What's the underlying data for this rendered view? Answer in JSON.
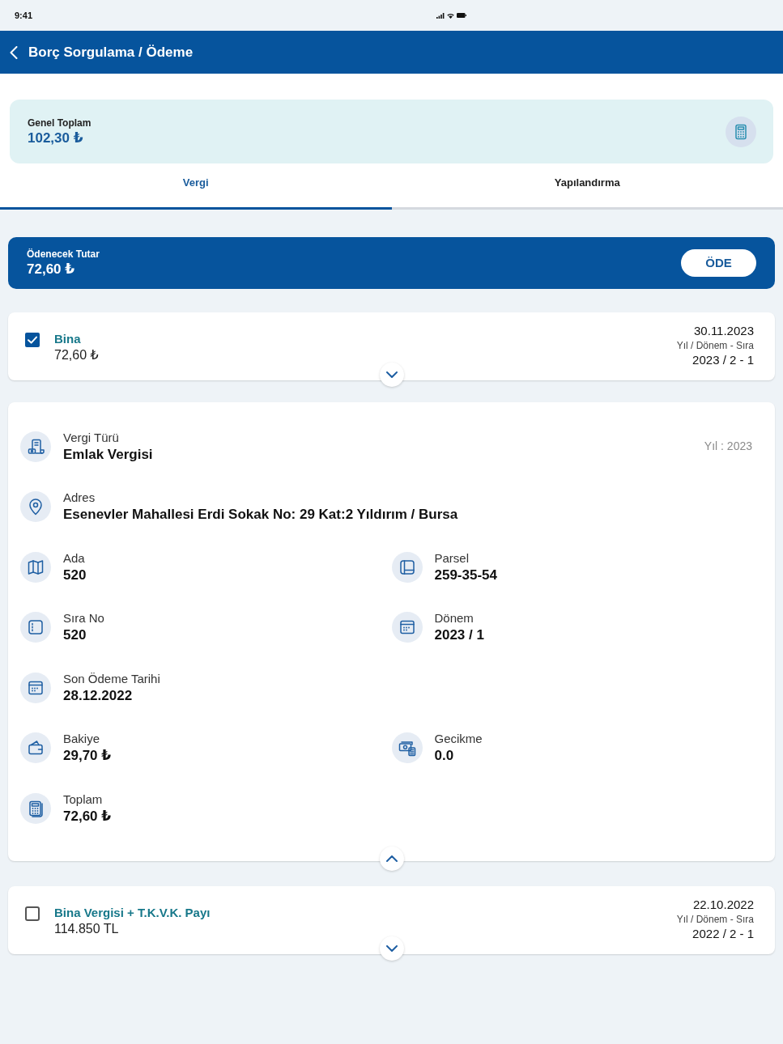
{
  "status_bar": {
    "time": "9:41"
  },
  "app_bar": {
    "title": "Borç Sorgulama / Ödeme"
  },
  "summary": {
    "label": "Genel Toplam",
    "amount": "102,30 ₺"
  },
  "tabs": [
    {
      "label": "Vergi",
      "selected": true
    },
    {
      "label": "Yapılandırma",
      "selected": false
    }
  ],
  "payment_banner": {
    "label": "Ödenecek Tutar",
    "amount": "72,60 ₺",
    "button": "ÖDE"
  },
  "debts": [
    {
      "title": "Bina",
      "amount": "72,60 ₺",
      "checked": true,
      "date": "30.11.2023",
      "period_label": "Yıl / Dönem - Sıra",
      "period": "2023 / 2 - 1",
      "details": {
        "rows": [
          {
            "note": "Yıl : 2023",
            "fields": [
              {
                "kind": "type",
                "label": "Vergi Türü",
                "value": "Emlak Vergisi"
              }
            ]
          },
          {
            "fields": [
              {
                "kind": "address",
                "label": "Adres",
                "value": "Esenevler Mahallesi Erdi Sokak No: 29 Kat:2 Yıldırım / Bursa"
              }
            ]
          },
          {
            "fields": [
              {
                "kind": "island",
                "label": "Ada",
                "value": "520"
              },
              {
                "kind": "parcel",
                "label": "Parsel",
                "value": "259-35-54"
              }
            ]
          },
          {
            "fields": [
              {
                "kind": "order",
                "label": "Sıra No",
                "value": "520"
              },
              {
                "kind": "period",
                "label": "Dönem",
                "value": "2023 / 1"
              }
            ]
          },
          {
            "fields": [
              {
                "kind": "due",
                "label": "Son Ödeme Tarihi",
                "value": "28.12.2022"
              }
            ]
          },
          {
            "fields": [
              {
                "kind": "balance",
                "label": "Bakiye",
                "value": "29,70 ₺"
              },
              {
                "kind": "delay",
                "label": "Gecikme",
                "value": "0.0"
              }
            ]
          },
          {
            "fields": [
              {
                "kind": "total",
                "label": "Toplam",
                "value": "72,60 ₺"
              }
            ]
          }
        ]
      }
    },
    {
      "title": "Bina Vergisi + T.K.V.K. Payı",
      "amount": "114.850 TL",
      "checked": false,
      "date": "22.10.2022",
      "period_label": "Yıl / Dönem - Sıra",
      "period": "2022 / 2 - 1"
    }
  ]
}
